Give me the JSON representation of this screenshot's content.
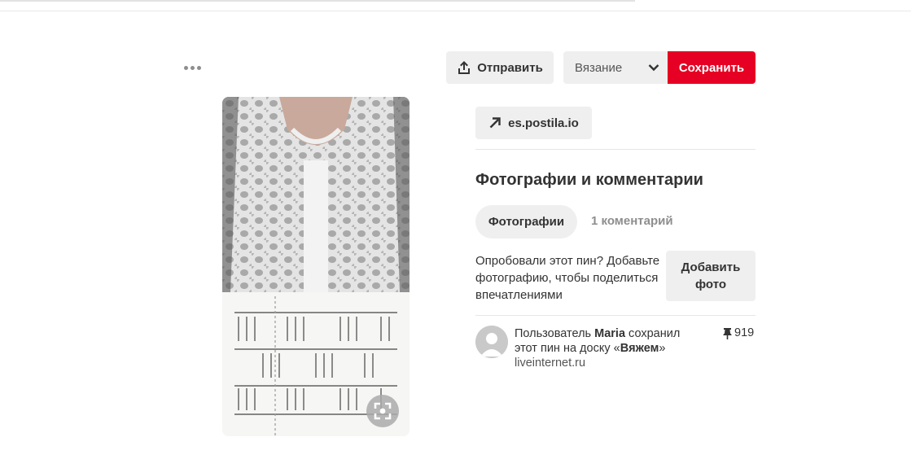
{
  "toolbar": {
    "share_label": "Отправить",
    "board_select_value": "Вязание",
    "save_label": "Сохранить"
  },
  "source": {
    "domain": "es.postila.io"
  },
  "photos_comments": {
    "title": "Фотографии и комментарии",
    "tab_photos": "Фотографии",
    "tab_comments": "1 коментарий",
    "tried_prompt": "Опробовали этот пин? Добавьте фотографию, чтобы поделиться впечатлениями",
    "add_photo_label": "Добавить фото"
  },
  "activity": {
    "prefix": "Пользователь ",
    "user": "Maria",
    "middle": " сохранил этот пин на доску «",
    "board": "Вяжем",
    "suffix": "»",
    "site": "liveinternet.ru",
    "pin_count": "919"
  },
  "colors": {
    "save_red": "#e60023",
    "button_gray": "#efefef"
  },
  "icons": [
    "more-dots-icon",
    "share-upload-icon",
    "chevron-down-icon",
    "arrow-up-right-icon",
    "visual-search-icon",
    "pin-icon",
    "avatar-icon"
  ]
}
